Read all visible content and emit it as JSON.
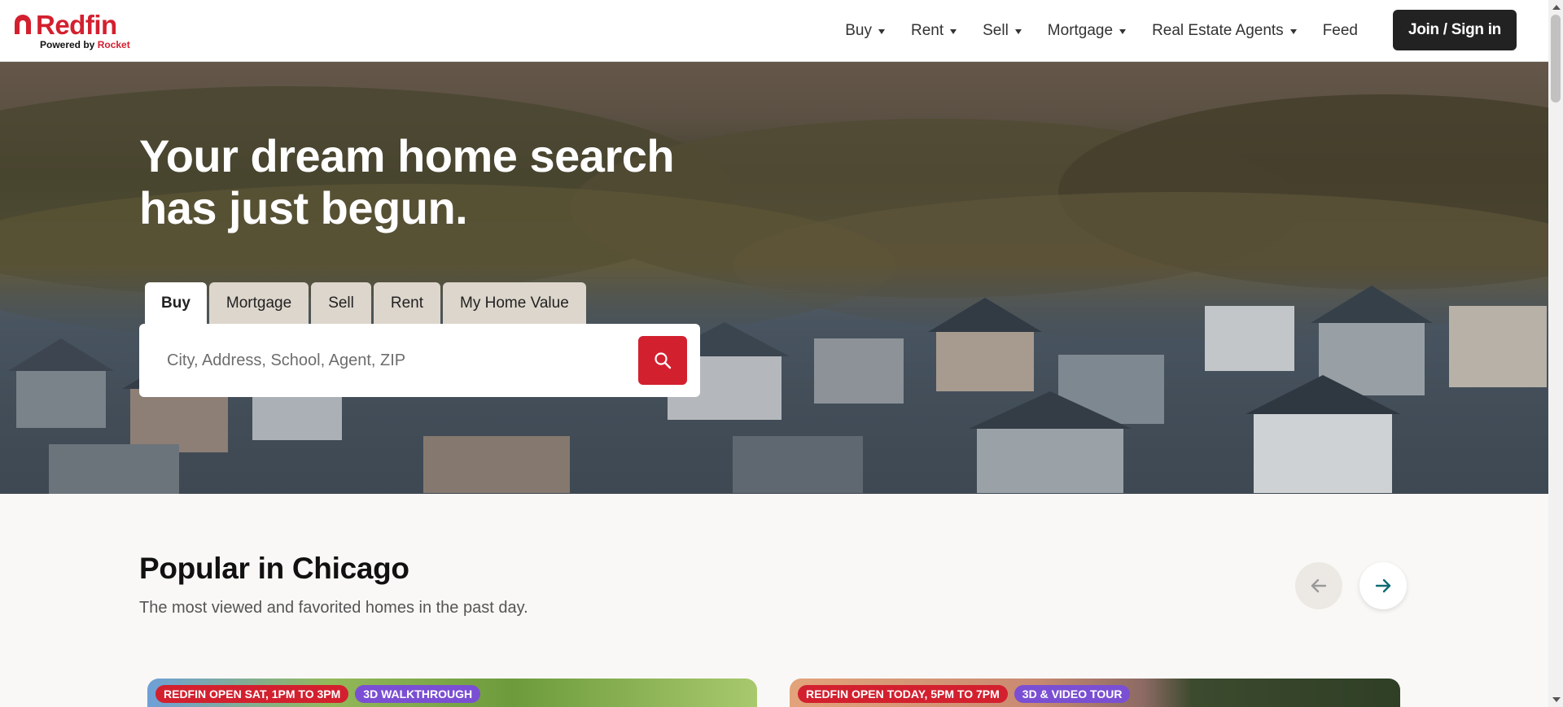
{
  "brand": {
    "name": "Redfin",
    "powered_by": "Powered by",
    "partner": "Rocket",
    "color": "#d3202f"
  },
  "nav": {
    "items": [
      {
        "label": "Buy",
        "has_dropdown": true
      },
      {
        "label": "Rent",
        "has_dropdown": true
      },
      {
        "label": "Sell",
        "has_dropdown": true
      },
      {
        "label": "Mortgage",
        "has_dropdown": true
      },
      {
        "label": "Real Estate Agents",
        "has_dropdown": true
      },
      {
        "label": "Feed",
        "has_dropdown": false
      }
    ],
    "join_label": "Join / Sign in"
  },
  "hero": {
    "title": "Your dream home search has just begun.",
    "tabs": [
      {
        "label": "Buy",
        "active": true
      },
      {
        "label": "Mortgage",
        "active": false
      },
      {
        "label": "Sell",
        "active": false
      },
      {
        "label": "Rent",
        "active": false
      },
      {
        "label": "My Home Value",
        "active": false
      }
    ],
    "search": {
      "placeholder": "City, Address, School, Agent, ZIP",
      "value": "",
      "button_icon": "search-icon"
    }
  },
  "popular": {
    "title": "Popular in Chicago",
    "subtitle": "The most viewed and favorited homes in the past day.",
    "prev_icon": "arrow-left-icon",
    "next_icon": "arrow-right-icon",
    "cards": [
      {
        "badges": [
          "REDFIN OPEN SAT, 1PM TO 3PM",
          "3D WALKTHROUGH"
        ]
      },
      {
        "badges": [
          "REDFIN OPEN TODAY, 5PM TO 7PM",
          "3D & VIDEO TOUR"
        ]
      }
    ]
  },
  "colors": {
    "accent": "#d3202f",
    "badge_purple": "#7b4fd3",
    "join_button": "#222222",
    "arrow_teal": "#0f6b73"
  }
}
